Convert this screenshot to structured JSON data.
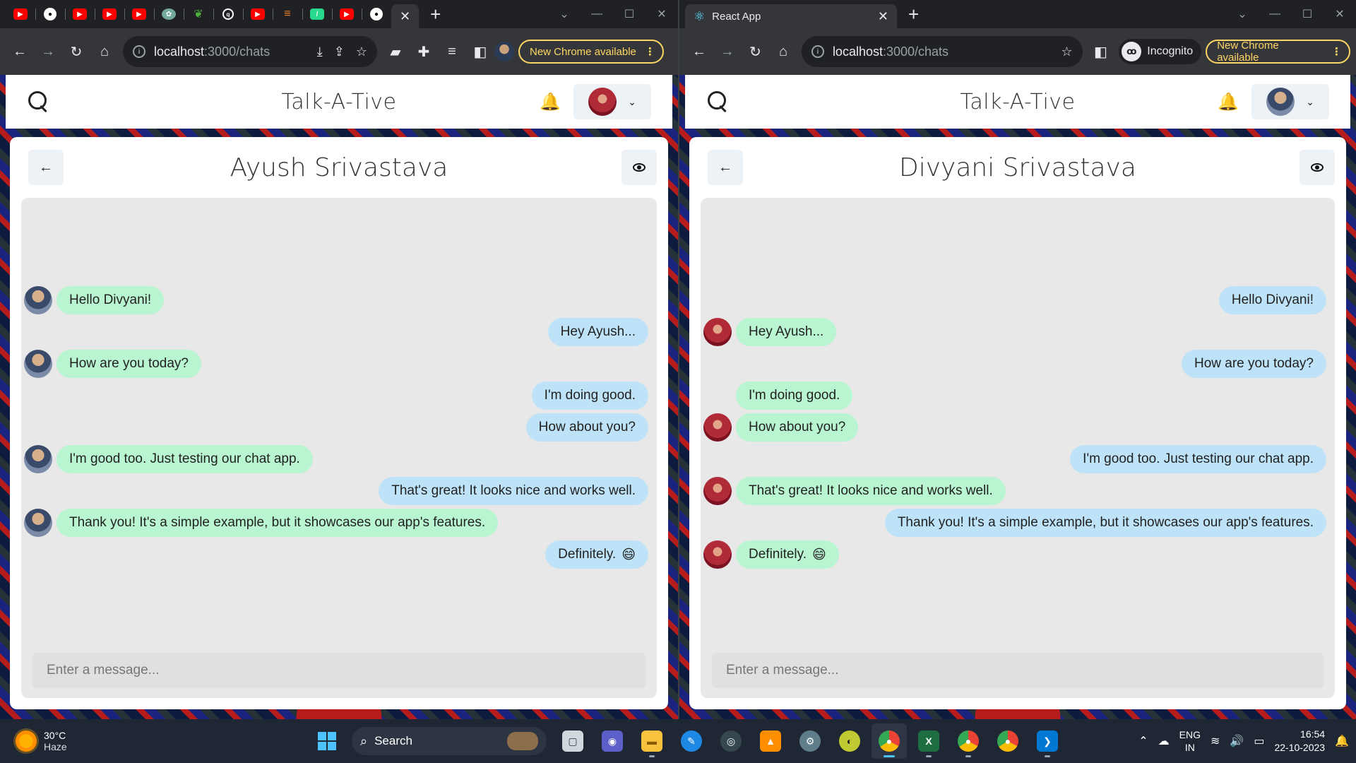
{
  "left_window": {
    "omnibox": {
      "host": "localhost",
      "path": ":3000/chats"
    },
    "update_button": "New Chrome available",
    "app": {
      "title": "Talk-A-Tive"
    },
    "chat": {
      "name": "Ayush Srivastava",
      "input_placeholder": "Enter a message...",
      "messages": [
        {
          "text": "Hello Divyani!",
          "side": "left",
          "color": "green",
          "avatar": true
        },
        {
          "text": "Hey Ayush...",
          "side": "right",
          "color": "blue",
          "avatar": false
        },
        {
          "text": "How are you today?",
          "side": "left",
          "color": "green",
          "avatar": true
        },
        {
          "text": "I'm doing good.",
          "side": "right",
          "color": "blue",
          "avatar": false
        },
        {
          "text": "How about you?",
          "side": "right",
          "color": "blue",
          "avatar": false
        },
        {
          "text": "I'm good too. Just testing our chat app.",
          "side": "left",
          "color": "green",
          "avatar": true
        },
        {
          "text": "That's great! It looks nice and works well.",
          "side": "right",
          "color": "blue",
          "avatar": false
        },
        {
          "text": "Thank you! It's a simple example, but it showcases our app's features.",
          "side": "left",
          "color": "green",
          "avatar": true
        },
        {
          "text": "Definitely.",
          "emoji": "😄",
          "side": "right",
          "color": "blue",
          "avatar": false
        }
      ]
    }
  },
  "right_window": {
    "tab_title": "React App",
    "omnibox": {
      "host": "localhost",
      "path": ":3000/chats"
    },
    "incognito_label": "Incognito",
    "update_button": "New Chrome available",
    "app": {
      "title": "Talk-A-Tive"
    },
    "chat": {
      "name": "Divyani Srivastava",
      "input_placeholder": "Enter a message...",
      "messages": [
        {
          "text": "Hello Divyani!",
          "side": "right",
          "color": "blue",
          "avatar": false
        },
        {
          "text": "Hey Ayush...",
          "side": "left",
          "color": "green",
          "avatar": true
        },
        {
          "text": "How are you today?",
          "side": "right",
          "color": "blue",
          "avatar": false
        },
        {
          "text": "I'm doing good.",
          "side": "left",
          "color": "green",
          "avatar": false
        },
        {
          "text": "How about you?",
          "side": "left",
          "color": "green",
          "avatar": true
        },
        {
          "text": "I'm good too. Just testing our chat app.",
          "side": "right",
          "color": "blue",
          "avatar": false
        },
        {
          "text": "That's great! It looks nice and works well.",
          "side": "left",
          "color": "green",
          "avatar": true
        },
        {
          "text": "Thank you! It's a simple example, but it showcases our app's features.",
          "side": "right",
          "color": "blue",
          "avatar": false
        },
        {
          "text": "Definitely.",
          "emoji": "😄",
          "side": "left",
          "color": "green",
          "avatar": true
        }
      ]
    }
  },
  "colors": {
    "bubble_green": "#b9f5d0",
    "bubble_blue": "#bee3f8",
    "update_accent": "#fdd663",
    "taskbar": "#1f2735"
  },
  "taskbar": {
    "weather": {
      "temp": "30°C",
      "condition": "Haze"
    },
    "search_label": "Search",
    "language": {
      "line1": "ENG",
      "line2": "IN"
    },
    "clock": {
      "time": "16:54",
      "date": "22-10-2023"
    }
  }
}
